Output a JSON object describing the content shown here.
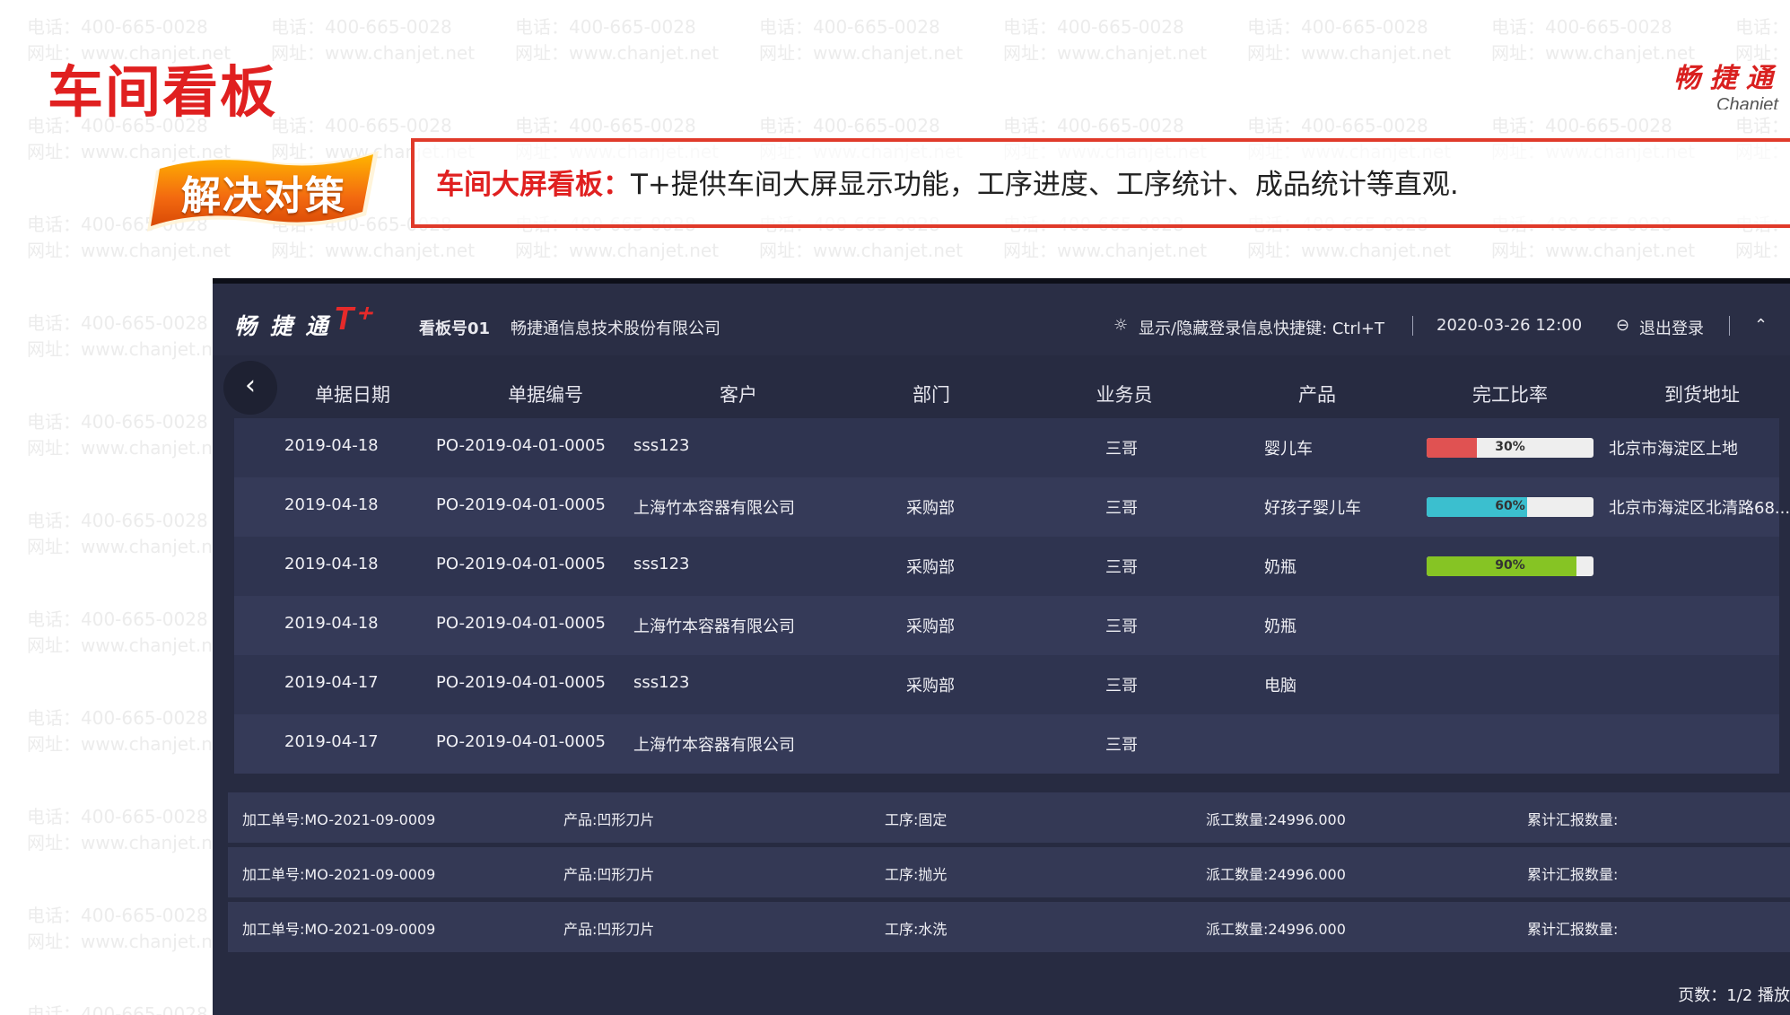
{
  "slide": {
    "title": "车间看板",
    "logo_cn": "畅 捷 通",
    "logo_en": "Chanjet",
    "badge": "解决对策",
    "description_highlight": "车间大屏看板：",
    "description_text": "T+提供车间大屏显示功能，工序进度、工序统计、成品统计等直观."
  },
  "watermark": {
    "phone": "电话：400-665-0028",
    "site": "网址：www.chanjet.net"
  },
  "app": {
    "brand": "畅 捷 通",
    "brand_mark": "T⁺",
    "board_no": "看板号01",
    "company": "畅捷通信息技术股份有限公司",
    "shortcut_hint": "显示/隐藏登录信息快捷键: Ctrl+T",
    "datetime": "2020-03-26 12:00",
    "logout": "退出登录",
    "icons": {
      "back": "chevron-left-icon",
      "hint": "lightbulb-icon",
      "logout": "logout-icon",
      "collapse": "chevron-up-icon"
    },
    "columns": [
      "单据日期",
      "单据编号",
      "客户",
      "部门",
      "业务员",
      "产品",
      "完工比率",
      "到货地址"
    ],
    "rows": [
      {
        "date": "2019-04-18",
        "code": "PO-2019-04-01-0005",
        "customer": "sss123",
        "dept": "",
        "salesman": "三哥",
        "product": "婴儿车",
        "progress": 30,
        "progress_label": "30%",
        "color": "#e05252",
        "address": "北京市海淀区上地"
      },
      {
        "date": "2019-04-18",
        "code": "PO-2019-04-01-0005",
        "customer": "上海竹本容器有限公司",
        "dept": "采购部",
        "salesman": "三哥",
        "product": "好孩子婴儿车",
        "progress": 60,
        "progress_label": "60%",
        "color": "#3bbfcf",
        "address": "北京市海淀区北清路68..."
      },
      {
        "date": "2019-04-18",
        "code": "PO-2019-04-01-0005",
        "customer": "sss123",
        "dept": "采购部",
        "salesman": "三哥",
        "product": "奶瓶",
        "progress": 90,
        "progress_label": "90%",
        "color": "#86c424",
        "address": ""
      },
      {
        "date": "2019-04-18",
        "code": "PO-2019-04-01-0005",
        "customer": "上海竹本容器有限公司",
        "dept": "采购部",
        "salesman": "三哥",
        "product": "奶瓶",
        "progress": null,
        "progress_label": "",
        "color": "",
        "address": ""
      },
      {
        "date": "2019-04-17",
        "code": "PO-2019-04-01-0005",
        "customer": "sss123",
        "dept": "采购部",
        "salesman": "三哥",
        "product": "电脑",
        "progress": null,
        "progress_label": "",
        "color": "",
        "address": ""
      },
      {
        "date": "2019-04-17",
        "code": "PO-2019-04-01-0005",
        "customer": "上海竹本容器有限公司",
        "dept": "",
        "salesman": "三哥",
        "product": "",
        "progress": null,
        "progress_label": "",
        "color": "",
        "address": ""
      }
    ],
    "jobs": [
      {
        "order": "加工单号:MO-2021-09-0009",
        "product": "产品:凹形刀片",
        "process": "工序:固定",
        "qty": "派工数量:24996.000",
        "reported": "累计汇报数量:"
      },
      {
        "order": "加工单号:MO-2021-09-0009",
        "product": "产品:凹形刀片",
        "process": "工序:抛光",
        "qty": "派工数量:24996.000",
        "reported": "累计汇报数量:"
      },
      {
        "order": "加工单号:MO-2021-09-0009",
        "product": "产品:凹形刀片",
        "process": "工序:水洗",
        "qty": "派工数量:24996.000",
        "reported": "累计汇报数量:"
      }
    ],
    "pager": "页数：1/2 播放"
  }
}
